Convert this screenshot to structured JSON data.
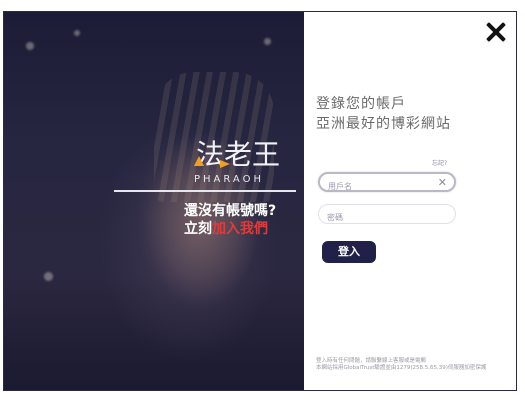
{
  "hero": {
    "brand_name": "PHARAOH",
    "logo_chars": "法老王",
    "signup_line1": "還沒有帳號嗎?",
    "signup_prefix": "立刻",
    "signup_link": "加入我們"
  },
  "form": {
    "title_line1": "登錄您的帳戶",
    "title_line2": "亞洲最好的博彩網站",
    "forgot_label": "忘記?",
    "username_placeholder": "用戶名",
    "password_placeholder": "密碼",
    "clear_symbol": "✕",
    "login_label": "登入",
    "footer_line1": "登入時有任何問題，請聯繫線上客服或是電郵",
    "footer_line2": "本網站採用GlobalTrust驗證並由1279(258.5,65,39)伺服器加密保護"
  },
  "colors": {
    "accent_red": "#e23b3b",
    "button_navy": "#202048",
    "hero_dark": "#1c1c36"
  },
  "icons": {
    "close": "close-icon",
    "clear": "clear-icon"
  }
}
